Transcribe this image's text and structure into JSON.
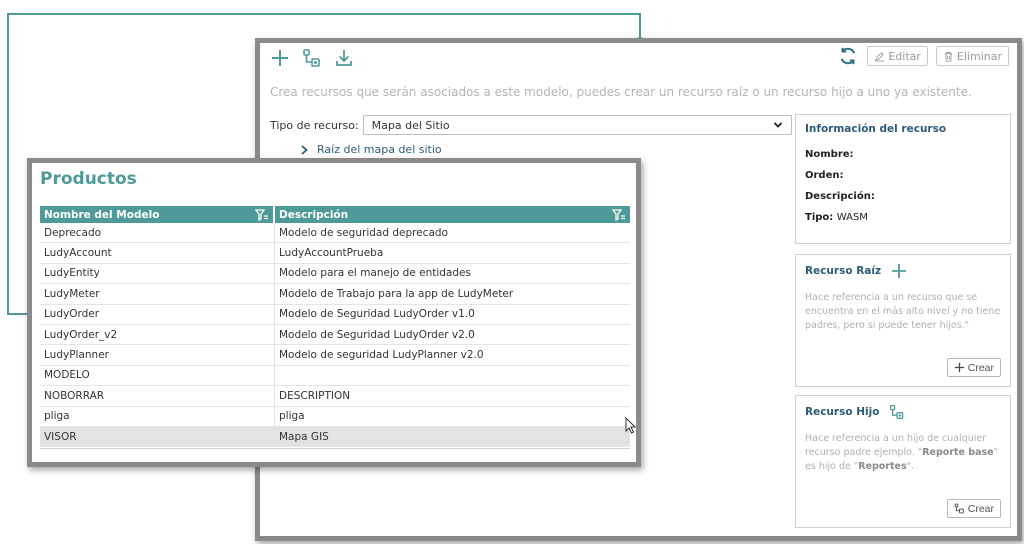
{
  "back": {
    "toolbar": {
      "add_icon": "plus-icon",
      "child_icon": "hierarchy-icon",
      "download_icon": "download-icon",
      "refresh_icon": "refresh-icon",
      "edit_label": "Editar",
      "delete_label": "Eliminar"
    },
    "hint": "Crea recursos que serán asociados a este modelo, puedes crear un recurso raíz o un recurso hijo a uno ya existente.",
    "type_label": "Tipo de recurso:",
    "type_value": "Mapa del Sitio",
    "tree_root": "Raíz del mapa del sitio",
    "info": {
      "title": "Información del recurso",
      "name_label": "Nombre:",
      "order_label": "Orden:",
      "description_label": "Descripción:",
      "type_label": "Tipo:",
      "type_value": "WASM"
    },
    "root_card": {
      "title": "Recurso Raíz",
      "desc": "Hace referencia a un recurso que se encuentra en el más alto nivel y no tiene padres, pero si puede tener hijos.\"",
      "button": "Crear"
    },
    "child_card": {
      "title": "Recurso Hijo",
      "desc_a": "Hace referencia a un hijo de cualquier recurso padre ejemplo. \"",
      "desc_b": "Reporte base",
      "desc_c": "\" es hijo de \"",
      "desc_d": "Reportes",
      "desc_e": "\".",
      "button": "Crear"
    }
  },
  "front": {
    "title": "Productos",
    "columns": [
      "Nombre del Modelo",
      "Descripción"
    ],
    "rows": [
      [
        "Deprecado",
        "Modelo de seguridad deprecado"
      ],
      [
        "LudyAccount",
        "LudyAccountPrueba"
      ],
      [
        "LudyEntity",
        "Modelo para el manejo de entidades"
      ],
      [
        "LudyMeter",
        "Modelo de Trabajo para la app de LudyMeter"
      ],
      [
        "LudyOrder",
        "Modelo de Seguridad LudyOrder v1.0"
      ],
      [
        "LudyOrder_v2",
        "Modelo de Seguridad LudyOrder v2.0"
      ],
      [
        "LudyPlanner",
        "Modelo de seguridad LudyPlanner v2.0"
      ],
      [
        "MODELO",
        ""
      ],
      [
        "NOBORRAR",
        "DESCRIPTION"
      ],
      [
        "pliga",
        "pliga"
      ],
      [
        "VISOR",
        "Mapa GIS"
      ]
    ],
    "selected_row": 10
  },
  "colors": {
    "accent": "#4e9a98",
    "link": "#2d5b78",
    "frame": "#8a8a8a"
  }
}
